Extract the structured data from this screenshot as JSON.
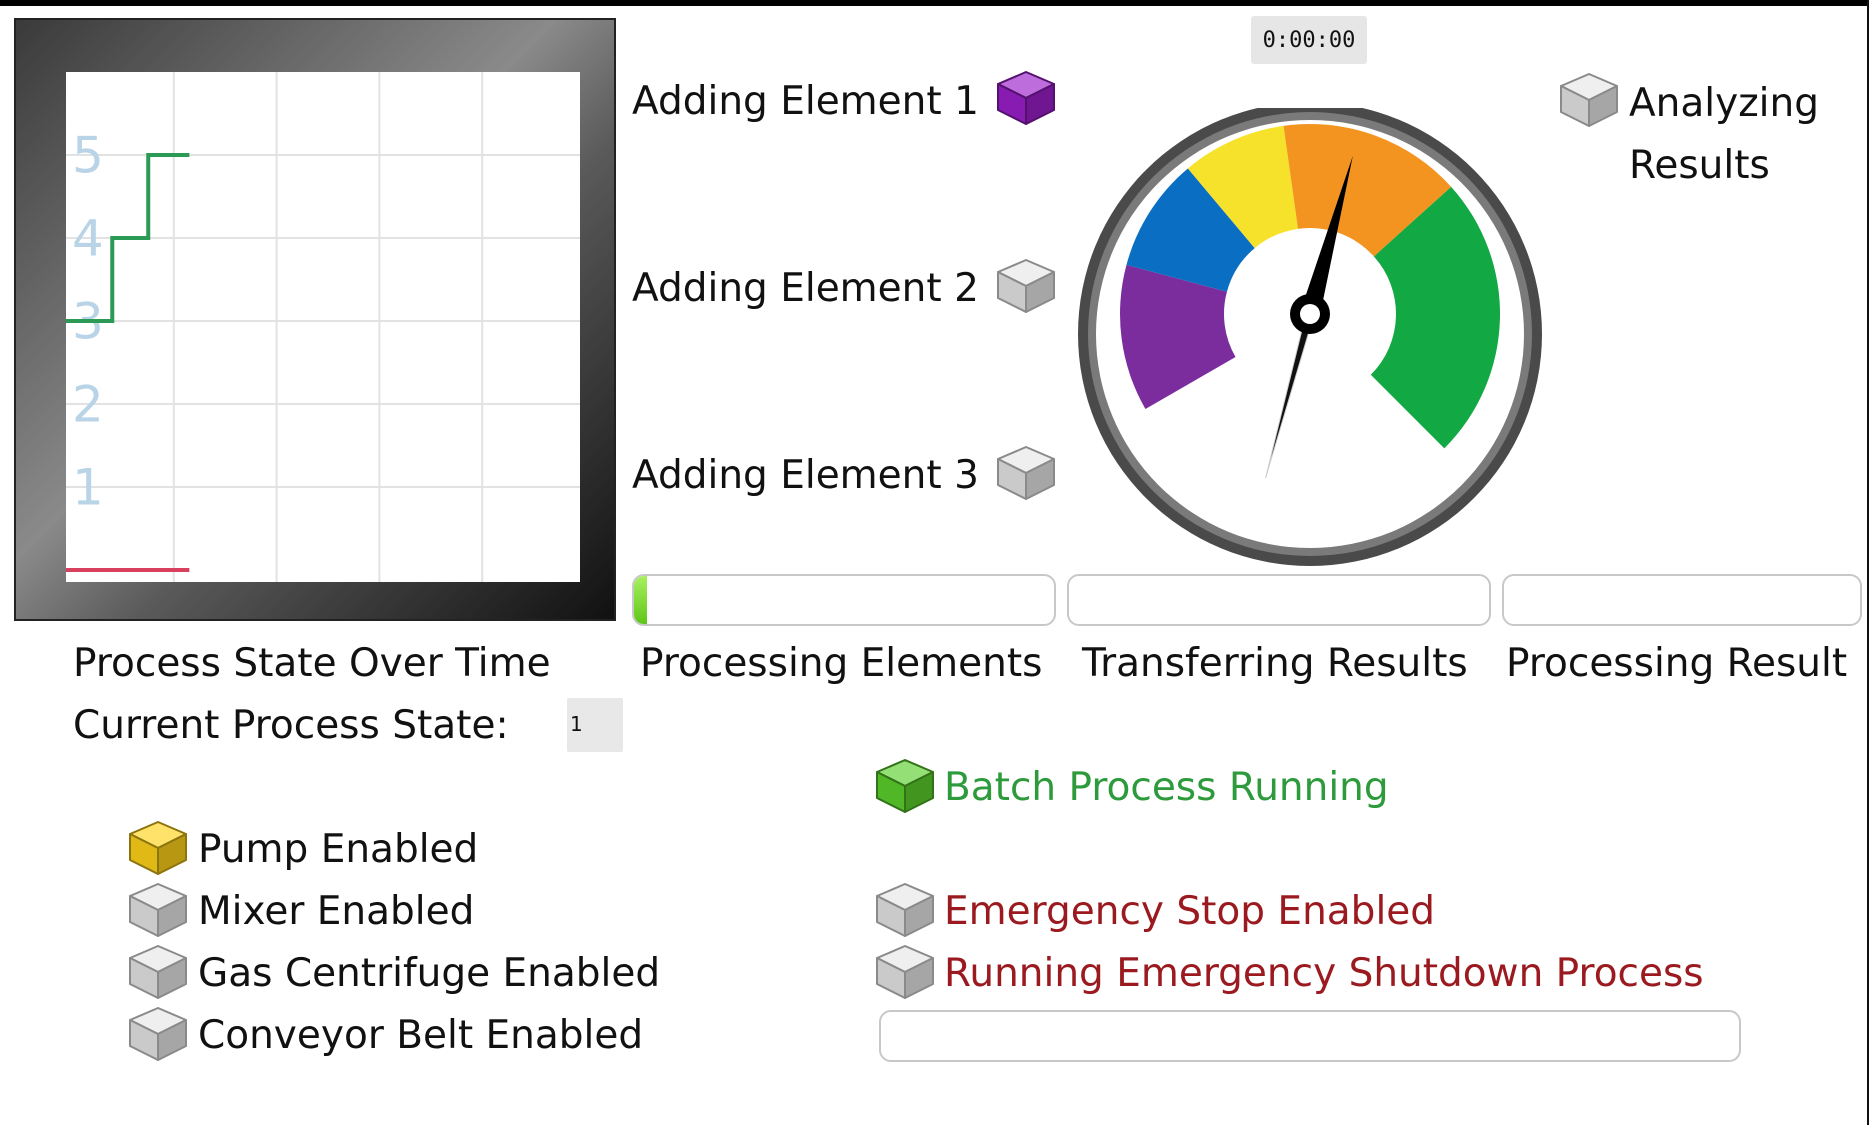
{
  "timer": "0:00:00",
  "chart": {
    "title": "Process State Over Time",
    "current_label": "Current Process State:",
    "current_value": "1"
  },
  "chart_data": {
    "type": "line",
    "y_ticks": [
      "1",
      "2",
      "3",
      "4",
      "5"
    ],
    "ylim": [
      0,
      6
    ],
    "xlim": [
      0,
      5
    ],
    "grid": true,
    "series": [
      {
        "color": "#2a9a55",
        "x": [
          0,
          0.45,
          0.45,
          0.8,
          0.8,
          1.2
        ],
        "y": [
          3,
          3,
          4,
          4,
          5,
          5
        ]
      },
      {
        "color": "#d94060",
        "x": [
          0,
          1.2
        ],
        "y": [
          0,
          0
        ]
      }
    ]
  },
  "elements": {
    "adding_1": "Adding Element 1",
    "adding_2": "Adding Element 2",
    "adding_3": "Adding Element 3",
    "analyzing": "Analyzing",
    "results": "Results"
  },
  "progress": {
    "processing_elements": {
      "label": "Processing Elements",
      "value": 0.03
    },
    "transferring_results": {
      "label": "Transferring Results",
      "value": 0
    },
    "processing_result": {
      "label": "Processing Result",
      "value": 0
    },
    "emergency_shutdown": {
      "value": 0
    }
  },
  "status": {
    "batch_running": "Batch Process Running",
    "pump": "Pump Enabled",
    "mixer": "Mixer Enabled",
    "gas_centrifuge": "Gas Centrifuge Enabled",
    "conveyor": "Conveyor Belt Enabled",
    "emergency_stop": "Emergency Stop Enabled",
    "emergency_shutdown": "Running Emergency Shutdown Process"
  },
  "gauge": {
    "value_fraction": 0.53,
    "segments": [
      {
        "color": "#7b2d9e"
      },
      {
        "color": "#0a6fc2"
      },
      {
        "color": "#f6e22a"
      },
      {
        "color": "#f39420"
      },
      {
        "color": "#12a844"
      }
    ]
  },
  "indicator_colors": {
    "inactive": "#e6e6e6",
    "purple": "#9b1fc9",
    "yellow": "#ffd21a",
    "green": "#5bd02c"
  }
}
